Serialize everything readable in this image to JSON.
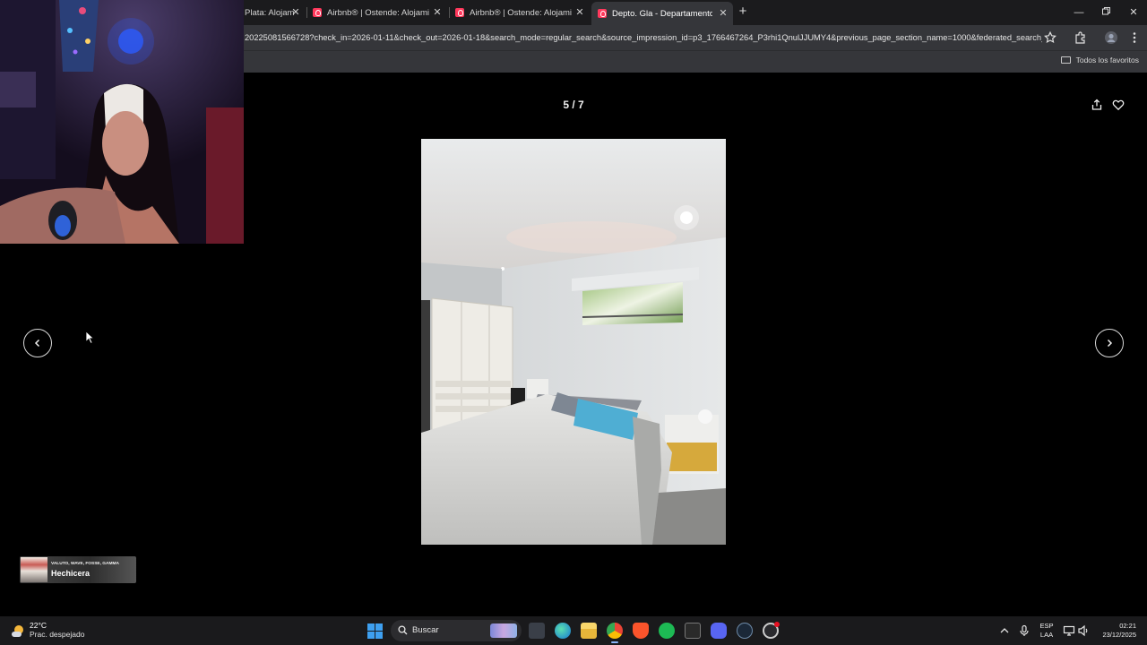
{
  "browser": {
    "tabs": [
      {
        "title": "Plata: Alojam",
        "active": false
      },
      {
        "title": "Airbnb® | Ostende: Alojamient",
        "active": false
      },
      {
        "title": "Airbnb® | Ostende: Alojamient",
        "active": false
      },
      {
        "title": "Depto. Gla - Departamentos en",
        "active": true
      }
    ],
    "new_tab_label": "+",
    "url": "20225081566728?check_in=2026-01-11&check_out=2026-01-18&search_mode=regular_search&source_impression_id=p3_1766467264_P3rhi1QnulJJUMY4&previous_page_section_name=1000&federated_search_i...",
    "bookmarks_label": "Todos los favoritos"
  },
  "viewer": {
    "counter": "5 / 7",
    "current": 5,
    "total": 7
  },
  "now_playing": {
    "artist": "VALUTO, WAVE, FOSSE, GAMMA",
    "title": "Hechicera"
  },
  "taskbar": {
    "temperature": "22°C",
    "weather": "Prac. despejado",
    "search_placeholder": "Buscar",
    "lang_primary": "ESP",
    "lang_secondary": "LAA",
    "time": "02:21",
    "date": "23/12/2025"
  },
  "colors": {
    "airbnb_brand": "#ff385c",
    "chrome_dark": "#202124",
    "taskbar": "#1a1a1c",
    "windows_blue": "#3ea0f0"
  },
  "icons": [
    "airbnb-favicon",
    "close-icon",
    "minimize-icon",
    "maximize-icon",
    "star-icon",
    "extensions-icon",
    "profile-icon",
    "kebab-menu-icon",
    "folder-icon",
    "share-icon",
    "heart-icon",
    "chevron-left-icon",
    "chevron-right-icon",
    "windows-start-icon",
    "search-icon"
  ]
}
